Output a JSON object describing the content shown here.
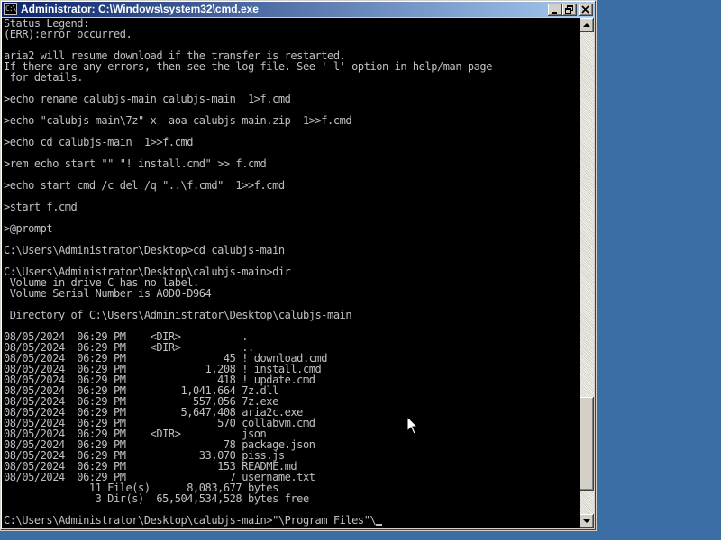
{
  "window": {
    "title": "Administrator: C:\\Windows\\system32\\cmd.exe",
    "icon_text": "C:\\"
  },
  "title_buttons": {
    "minimize_icon": "minimize-icon",
    "maximize_icon": "maximize-icon",
    "close_icon": "close-icon"
  },
  "console": {
    "lines": [
      "Status Legend:",
      "(ERR):error occurred.",
      "",
      "aria2 will resume download if the transfer is restarted.",
      "If there are any errors, then see the log file. See '-l' option in help/man page",
      " for details.",
      "",
      ">echo rename calubjs-main calubjs-main  1>f.cmd",
      "",
      ">echo \"calubjs-main\\7z\" x -aoa calubjs-main.zip  1>>f.cmd",
      "",
      ">echo cd calubjs-main  1>>f.cmd",
      "",
      ">rem echo start \"\" \"! install.cmd\" >> f.cmd",
      "",
      ">echo start cmd /c del /q \"..\\f.cmd\"  1>>f.cmd",
      "",
      ">start f.cmd",
      "",
      ">@prompt",
      "",
      "C:\\Users\\Administrator\\Desktop>cd calubjs-main",
      "",
      "C:\\Users\\Administrator\\Desktop\\calubjs-main>dir",
      " Volume in drive C has no label.",
      " Volume Serial Number is A0D0-D964",
      "",
      " Directory of C:\\Users\\Administrator\\Desktop\\calubjs-main",
      "",
      "08/05/2024  06:29 PM    <DIR>          .",
      "08/05/2024  06:29 PM    <DIR>          ..",
      "08/05/2024  06:29 PM                45 ! download.cmd",
      "08/05/2024  06:29 PM             1,208 ! install.cmd",
      "08/05/2024  06:29 PM               418 ! update.cmd",
      "08/05/2024  06:29 PM         1,041,664 7z.dll",
      "08/05/2024  06:29 PM           557,056 7z.exe",
      "08/05/2024  06:29 PM         5,647,408 aria2c.exe",
      "08/05/2024  06:29 PM               570 collabvm.cmd",
      "08/05/2024  06:29 PM    <DIR>          json",
      "08/05/2024  06:29 PM                78 package.json",
      "08/05/2024  06:29 PM            33,070 piss.js",
      "08/05/2024  06:29 PM               153 README.md",
      "08/05/2024  06:29 PM                 7 username.txt",
      "              11 File(s)      8,083,677 bytes",
      "               3 Dir(s)  65,504,534,528 bytes free",
      "",
      "C:\\Users\\Administrator\\Desktop\\calubjs-main>\"\\Program Files\"\\"
    ]
  },
  "scrollbar": {
    "up_icon": "scroll-up-arrow-icon",
    "down_icon": "scroll-down-arrow-icon",
    "position_fraction": 0.94
  },
  "pointer": {
    "icon": "mouse-pointer-icon"
  }
}
